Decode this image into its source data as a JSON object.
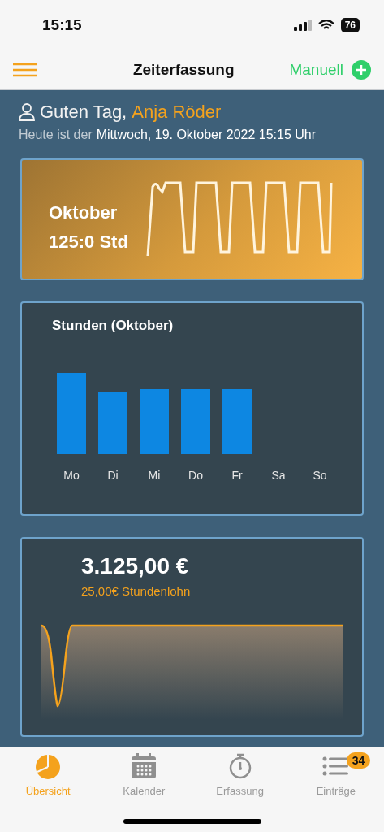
{
  "status_bar": {
    "time": "15:15",
    "battery": "76"
  },
  "nav": {
    "title": "Zeiterfassung",
    "action": "Manuell"
  },
  "greeting": {
    "prefix": "Guten Tag,",
    "name": "Anja Röder",
    "date_prefix": "Heute ist der",
    "date": "Mittwoch, 19. Oktober 2022 15:15 Uhr"
  },
  "month_card": {
    "month": "Oktober",
    "hours": "125:0 Std"
  },
  "hours_card": {
    "title": "Stunden (Oktober)",
    "day_labels": [
      "Mo",
      "Di",
      "Mi",
      "Do",
      "Fr",
      "Sa",
      "So"
    ]
  },
  "earnings_card": {
    "amount": "3.125,00 €",
    "rate": "25,00€ Stundenlohn"
  },
  "tabs": [
    {
      "label": "Übersicht",
      "selected": true
    },
    {
      "label": "Kalender",
      "selected": false
    },
    {
      "label": "Erfassung",
      "selected": false
    },
    {
      "label": "Einträge",
      "selected": false,
      "badge": "34"
    }
  ]
}
